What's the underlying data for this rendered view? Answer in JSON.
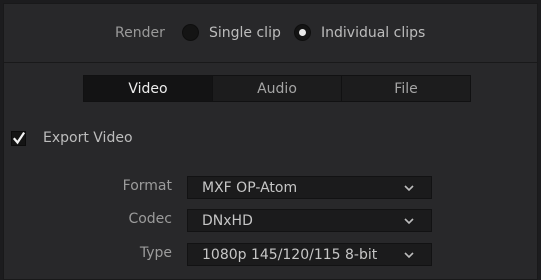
{
  "render": {
    "label": "Render",
    "options": [
      {
        "label": "Single clip",
        "selected": false
      },
      {
        "label": "Individual clips",
        "selected": true
      }
    ]
  },
  "tabs": [
    {
      "label": "Video",
      "active": true
    },
    {
      "label": "Audio",
      "active": false
    },
    {
      "label": "File",
      "active": false
    }
  ],
  "export_video": {
    "label": "Export Video",
    "checked": true
  },
  "fields": {
    "format": {
      "label": "Format",
      "value": "MXF OP-Atom"
    },
    "codec": {
      "label": "Codec",
      "value": "DNxHD"
    },
    "type": {
      "label": "Type",
      "value": "1080p 145/120/115 8-bit"
    }
  },
  "icons": {
    "checkbox": "checkmark-icon",
    "dropdown": "chevron-down-icon"
  }
}
